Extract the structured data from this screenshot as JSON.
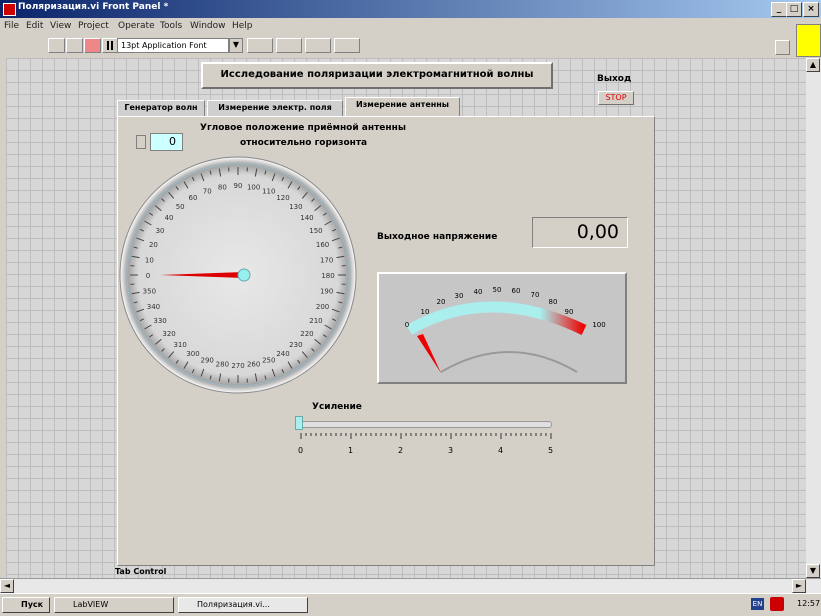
{
  "window": {
    "title": "Поляризация.vi Front Panel *"
  },
  "menu": [
    "File",
    "Edit",
    "View",
    "Project",
    "Operate",
    "Tools",
    "Window",
    "Help"
  ],
  "toolbar": {
    "font": "13pt Application Font"
  },
  "panel": {
    "title_button": "Исследование поляризации электромагнитной волны",
    "exit_label": "Выход",
    "exit_button": "STOP",
    "tabs": [
      "Генератор волн",
      "Измерение электр. поля",
      "Измерение антенны"
    ],
    "angle": {
      "label_line1": "Угловое положение приёмной антенны",
      "label_line2": "относительно горизонта",
      "value": "0"
    },
    "dial_ticks": [
      "0",
      "10",
      "20",
      "30",
      "40",
      "50",
      "60",
      "70",
      "80",
      "90",
      "100",
      "110",
      "120",
      "130",
      "140",
      "150",
      "160",
      "170",
      "180",
      "190",
      "200",
      "210",
      "220",
      "230",
      "240",
      "250",
      "260",
      "270",
      "280",
      "290",
      "300",
      "310",
      "320",
      "330",
      "340",
      "350"
    ],
    "output": {
      "label": "Выходное напряжение",
      "value": "0,00"
    },
    "meter_ticks": [
      "0",
      "10",
      "20",
      "30",
      "40",
      "50",
      "60",
      "70",
      "80",
      "90",
      "100"
    ],
    "gain": {
      "label": "Усиление",
      "value": 0,
      "ticks": [
        "0",
        "1",
        "2",
        "3",
        "4",
        "5"
      ]
    },
    "tab_control_label": "Tab Control"
  },
  "taskbar": {
    "start": "Пуск",
    "items": [
      "LabVIEW",
      "Поляризация.vi..."
    ],
    "lang": "EN",
    "clock": "12:57"
  },
  "colors": {
    "title_bar": "#0a246a",
    "needle": "#dd0000",
    "meter_arc": "#aaeeff",
    "input_bg": "#ccffff"
  }
}
